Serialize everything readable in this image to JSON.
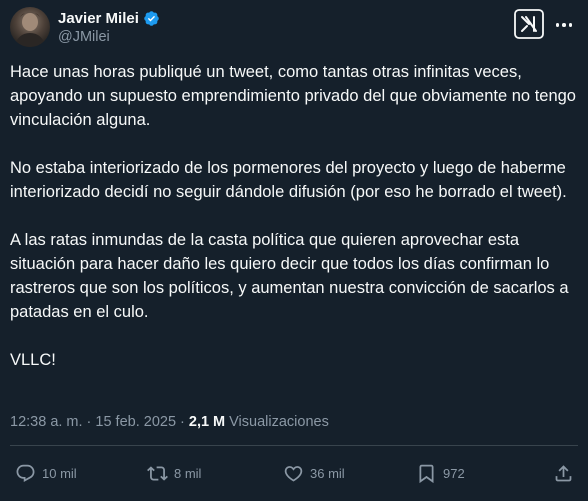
{
  "author": {
    "name": "Javier Milei",
    "handle": "@JMilei",
    "avatar_icon": "profile-photo"
  },
  "tweet": {
    "paragraphs": [
      "Hace unas horas publiqué un tweet, como tantas otras infinitas veces, apoyando un supuesto emprendimiento privado del que obviamente no tengo vinculación alguna.",
      "No estaba interiorizado de los pormenores del proyecto y luego de haberme interiorizado decidí no seguir dándole difusión (por eso he borrado el tweet).",
      "A las ratas inmundas de la casta política que quieren aprovechar esta situación para hacer daño les quiero decir que todos los días confirman lo rastreros que son los políticos, y aumentan nuestra convicción de sacarlos a patadas en el culo.",
      "VLLC!"
    ]
  },
  "meta": {
    "time": "12:38 a. m.",
    "separator": "·",
    "date": "15 feb. 2025",
    "views_count": "2,1 M",
    "views_label": "Visualizaciones"
  },
  "actions": {
    "replies": "10 mil",
    "retweets": "8 mil",
    "likes": "36 mil",
    "bookmarks": "972"
  },
  "colors": {
    "background": "#15202b",
    "text": "#f7f9f9",
    "secondary": "#8b98a5",
    "verified": "#1d9bf0"
  }
}
